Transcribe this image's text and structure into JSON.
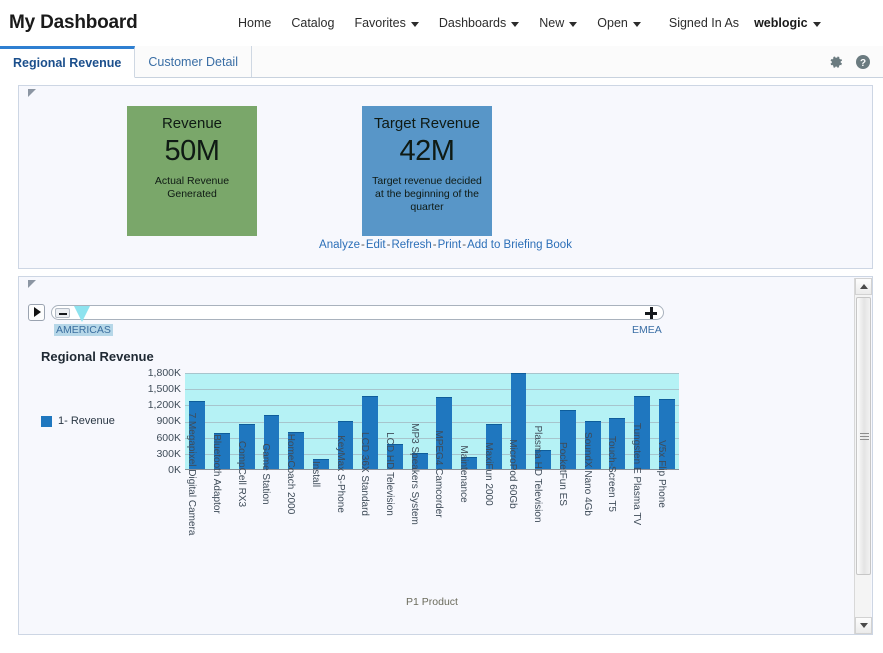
{
  "header": {
    "dashboard_title": "My Dashboard",
    "nav": [
      {
        "label": "Home",
        "has_caret": false
      },
      {
        "label": "Catalog",
        "has_caret": false
      },
      {
        "label": "Favorites",
        "has_caret": true
      },
      {
        "label": "Dashboards",
        "has_caret": true
      },
      {
        "label": "New",
        "has_caret": true
      },
      {
        "label": "Open",
        "has_caret": true
      }
    ],
    "signed_in_as_label": "Signed In As",
    "user_name": "weblogic",
    "icons": {
      "settings": "gear-icon",
      "help": "help-icon"
    }
  },
  "tabs": [
    {
      "label": "Regional Revenue",
      "active": true
    },
    {
      "label": "Customer Detail",
      "active": false
    }
  ],
  "kpi": {
    "tiles": [
      {
        "title": "Revenue",
        "value": "50M",
        "description": "Actual Revenue Generated",
        "color": "#7aa76a"
      },
      {
        "title": "Target Revenue",
        "value": "42M",
        "description": "Target revenue decided at the beginning of the quarter",
        "color": "#5896c8"
      }
    ],
    "links": [
      "Analyze",
      "Edit",
      "Refresh",
      "Print",
      "Add to Briefing Book"
    ],
    "link_separator": "-"
  },
  "slider": {
    "play_label": "play-button",
    "minus_label": "−",
    "plus_label": "+",
    "left_value": "AMERICAS",
    "right_value": "EMEA"
  },
  "chart_data": {
    "type": "bar",
    "title": "Regional Revenue",
    "xlabel": "P1 Product",
    "ylabel": "",
    "ylim": [
      0,
      1800000
    ],
    "ytick_labels": [
      "1,800K",
      "1,500K",
      "1,200K",
      "900K",
      "600K",
      "300K",
      "0K"
    ],
    "ytick_values": [
      1800000,
      1500000,
      1200000,
      900000,
      600000,
      300000,
      0
    ],
    "grid": true,
    "legend_position": "left",
    "legend": [
      "1- Revenue"
    ],
    "plot_bg": "#b5f2f5",
    "bar_color": "#1f77bf",
    "categories": [
      "7 Megapixel Digital Camera",
      "Bluetooth Adaptor",
      "CompCell RX3",
      "Game Station",
      "HomeCoach 2000",
      "Install",
      "KeyMax S-Phone",
      "LCD 36X Standard",
      "LCD HD Television",
      "MP3 Speakers System",
      "MPEG4 Camcorder",
      "Maintenance",
      "MaxiFun 2000",
      "MicroPod 60Gb",
      "Plasma HD Television",
      "PocketFun ES",
      "SoundX Nano 4Gb",
      "Touch-Screen T5",
      "Tungsten E Plasma TV",
      "V5x Flip Phone"
    ],
    "series": [
      {
        "name": "1- Revenue",
        "values": [
          1265000,
          670000,
          840000,
          1005000,
          690000,
          185000,
          895000,
          1360000,
          465000,
          300000,
          1345000,
          215000,
          835000,
          1775000,
          350000,
          1090000,
          895000,
          955000,
          1360000,
          1295000
        ]
      }
    ]
  }
}
